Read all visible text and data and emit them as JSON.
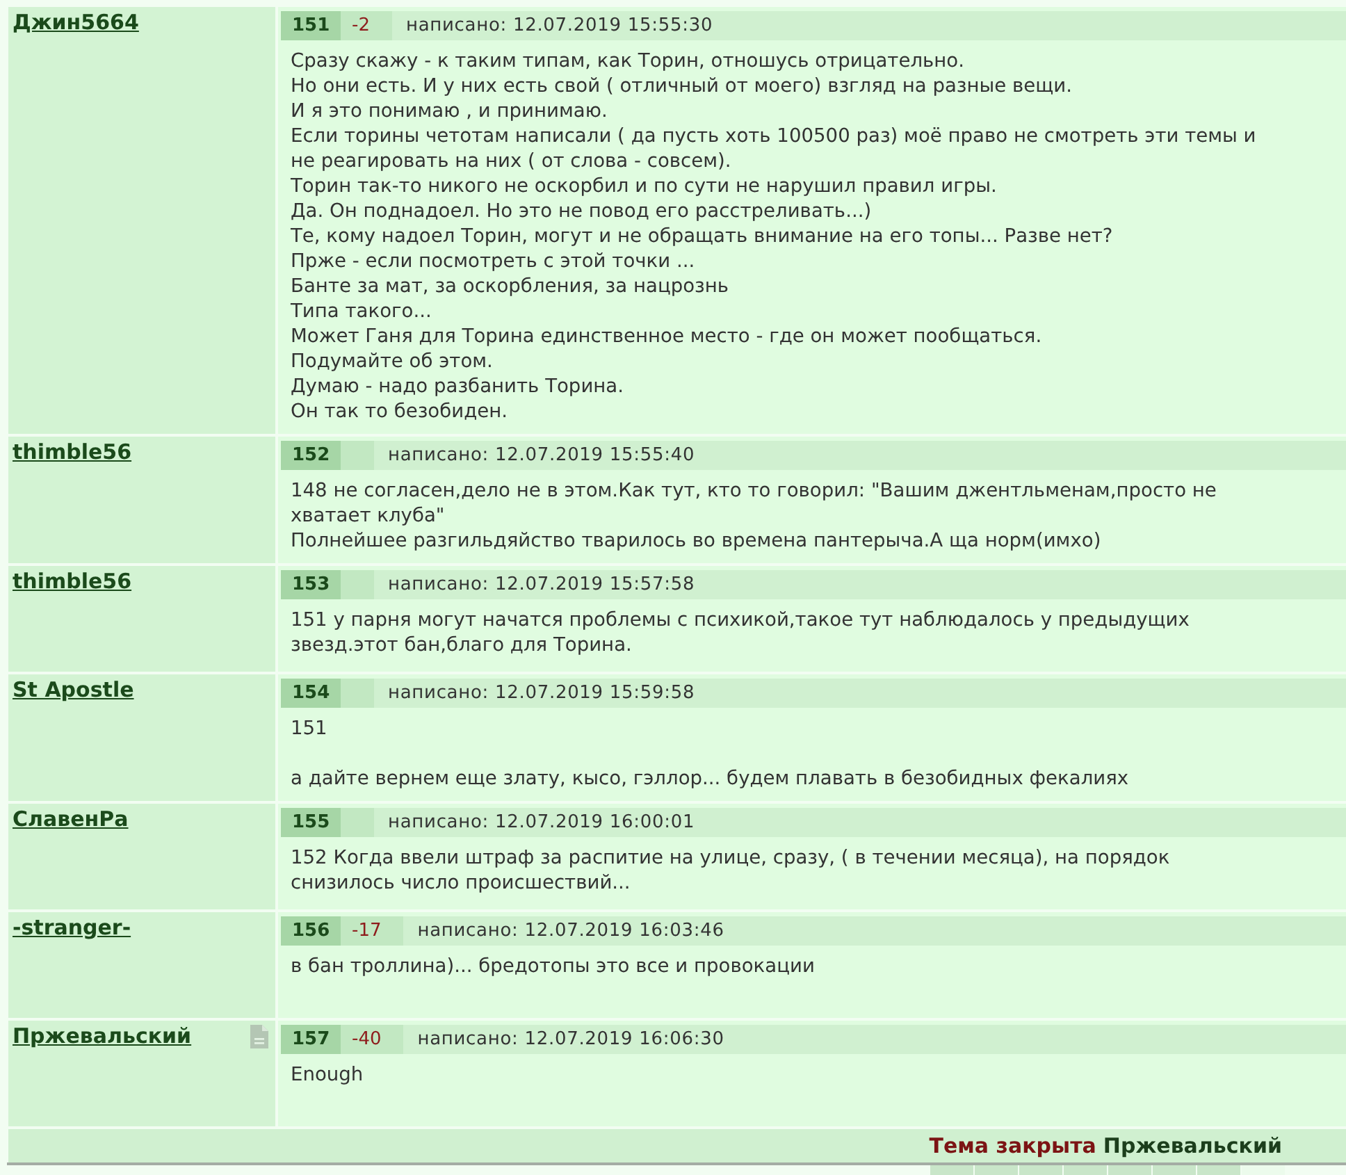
{
  "posts": [
    {
      "author": "Джин5664",
      "note_icon": false,
      "number": "151",
      "rating": "-2",
      "posted": "написано: 12.07.2019 15:55:30",
      "body": "Сразу скажу - к таким типам, как Торин, отношусь отрицательно.\nНо они есть. И у них есть свой ( отличный от моего) взгляд на разные вещи.\nИ я это понимаю , и принимаю.\nЕсли торины четотам написали ( да пусть хоть 100500 раз) моё право не смотреть эти темы и\nне реагировать на них ( от слова - совсем).\nТорин так-то никого не оскорбил и по сути не нарушил правил игры.\nДа. Он поднадоел. Но это не повод его расстреливать...)\nТе, кому надоел Торин, могут и не обращать внимание на его топы... Разве нет?\nПрже - если посмотреть с этой точки ...\nБанте за мат, за оскорбления, за нацрознь\nТипа такого...\nМожет Ганя для Торина единственное место - где он может пообщаться.\nПодумайте об этом.\nДумаю - надо разбанить Торина.\nОн так то безобиден."
    },
    {
      "author": "thimble56",
      "note_icon": false,
      "number": "152",
      "posted": "написано: 12.07.2019 15:55:40",
      "body": "148 не согласен,дело не в этом.Как тут, кто то говорил: \"Вашим джентльменам,просто не\nхватает клуба\"\nПолнейшее разгильдяйство тварилось во времена пантерыча.А ща норм(имхо)"
    },
    {
      "author": "thimble56",
      "note_icon": false,
      "number": "153",
      "posted": "написано: 12.07.2019 15:57:58",
      "body": "151 у парня могут начатся проблемы с психикой,такое тут наблюдалось у предыдущих\nзвезд.этот бан,благо для Торина."
    },
    {
      "author": "St Apostle",
      "note_icon": false,
      "number": "154",
      "posted": "написано: 12.07.2019 15:59:58",
      "body": "151\n\nа дайте вернем еще злату, кысо, гэллор... будем плавать в безобидных фекалиях"
    },
    {
      "author": "СлавенРа",
      "note_icon": false,
      "number": "155",
      "posted": "написано: 12.07.2019 16:00:01",
      "body": "152 Когда ввели штраф за распитие на улице, сразу, ( в течении месяца), на порядок\nснизилось число происшествий..."
    },
    {
      "author": "-stranger-",
      "note_icon": false,
      "number": "156",
      "rating": "-17",
      "posted": "написано: 12.07.2019 16:03:46",
      "body": "в бан троллина)... бредотопы это все и провокации"
    },
    {
      "author": "Пржевальский",
      "note_icon": true,
      "number": "157",
      "rating": "-40",
      "posted": "написано: 12.07.2019 16:06:30",
      "body": "Enough"
    }
  ],
  "footer": {
    "status": "Тема закрыта",
    "moderator": "Пржевальский"
  },
  "pager": [
    {
      "selected": false
    },
    {
      "selected": false
    },
    {
      "selected": false
    },
    {
      "selected": false
    },
    {
      "selected": false
    },
    {
      "selected": false
    },
    {
      "selected": false
    },
    {
      "selected": true
    }
  ]
}
